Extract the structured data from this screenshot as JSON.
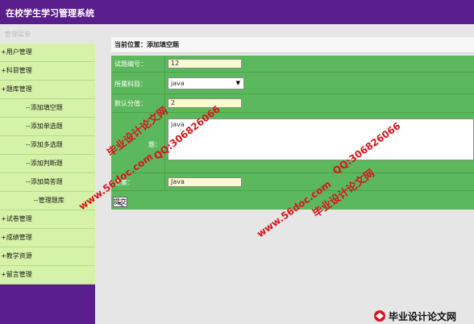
{
  "app": {
    "title": "在校学生学习管理系统"
  },
  "sidebar": {
    "header": "管理菜单",
    "items": [
      {
        "label": "+用户管理",
        "level": "top"
      },
      {
        "label": "+科目管理",
        "level": "top"
      },
      {
        "label": "+题库管理",
        "level": "top"
      },
      {
        "label": "--添加填空题",
        "level": "sub"
      },
      {
        "label": "--添加单选题",
        "level": "sub"
      },
      {
        "label": "--添加多选题",
        "level": "sub"
      },
      {
        "label": "--添加判断题",
        "level": "sub"
      },
      {
        "label": "--添加简答题",
        "level": "sub"
      },
      {
        "label": "--管理题库",
        "level": "sub2"
      },
      {
        "label": "+试卷管理",
        "level": "top"
      },
      {
        "label": "+成绩管理",
        "level": "top"
      },
      {
        "label": "+教学资源",
        "level": "top"
      },
      {
        "label": "+留言管理",
        "level": "top"
      }
    ]
  },
  "main": {
    "breadcrumb": "当前位置：添加填空题",
    "form": {
      "question_id_label": "试题编号：",
      "question_id_value": "12",
      "subject_label": "所属科目：",
      "subject_value": "java",
      "score_label": "默认分值：",
      "score_value": "2",
      "question_label": "题：",
      "question_value": "java",
      "answer_label": "答案：",
      "answer_value": "Java",
      "submit_label": "提交"
    }
  },
  "watermarks": {
    "text1": "毕业设计论文网",
    "text2": "www.56doc.com",
    "text3": "QQ:306826066"
  },
  "logo": {
    "text": "毕业设计论文网"
  },
  "colors": {
    "header": "#5a1d8c",
    "menu_bg": "#d5f2a8",
    "form_bg": "#5cb85c",
    "watermark": "#d8141c"
  }
}
